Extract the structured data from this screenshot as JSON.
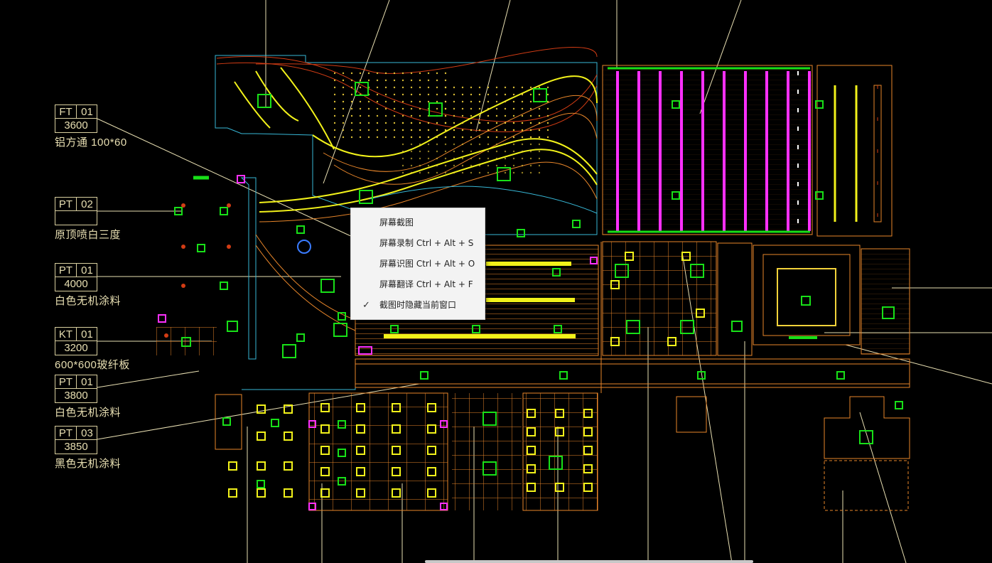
{
  "tags": [
    {
      "code": "FT",
      "num": "01",
      "height": "3600",
      "desc": "铝方通 100*60"
    },
    {
      "code": "PT",
      "num": "02",
      "height": "",
      "desc": "原顶喷白三度"
    },
    {
      "code": "PT",
      "num": "01",
      "height": "4000",
      "desc": "白色无机涂料"
    },
    {
      "code": "KT",
      "num": "01",
      "height": "3200",
      "desc": "600*600玻纤板"
    },
    {
      "code": "PT",
      "num": "01",
      "height": "3800",
      "desc": "白色无机涂料"
    },
    {
      "code": "PT",
      "num": "03",
      "height": "3850",
      "desc": "黑色无机涂料"
    }
  ],
  "context_menu": {
    "items": [
      {
        "label": "屏幕截图",
        "checked": false
      },
      {
        "label": "屏幕录制 Ctrl + Alt + S",
        "checked": false
      },
      {
        "label": "屏幕识图 Ctrl + Alt + O",
        "checked": false
      },
      {
        "label": "屏幕翻译 Ctrl + Alt + F",
        "checked": false
      },
      {
        "label": "截图时隐藏当前窗口",
        "checked": true
      }
    ],
    "check_icon": "check-icon"
  },
  "colors": {
    "background": "#000000",
    "tag_text": "#e8dfb2",
    "line_orange": "#e8862a",
    "line_yellow": "#f2f21a",
    "line_red": "#d23c14",
    "line_green": "#18e018",
    "line_magenta": "#ff30ff",
    "line_cyan": "#37b7d6",
    "menu_bg": "#f3f3f3"
  }
}
